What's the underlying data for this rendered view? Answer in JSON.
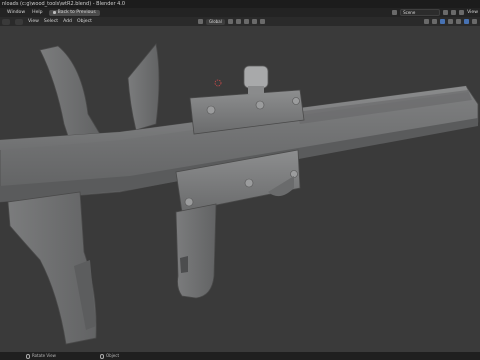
{
  "window": {
    "title": "nloads (c:g\\wood_tools\\wtR2.blend) - Blender 4.0"
  },
  "menubar": {
    "items": [
      "Window",
      "Help"
    ],
    "back_button": "Back to Previous",
    "scene_label": "Scene",
    "view_layer_label": "View"
  },
  "header": {
    "menus": [
      "View",
      "Select",
      "Add",
      "Object"
    ],
    "transform_orientation": "Global"
  },
  "statusbar": {
    "rotate_view": "Rotate View",
    "object": "Object"
  },
  "colors": {
    "accent": "#4772b3",
    "viewport_bg": "#3a3a3a",
    "metal": "#6f7071"
  }
}
